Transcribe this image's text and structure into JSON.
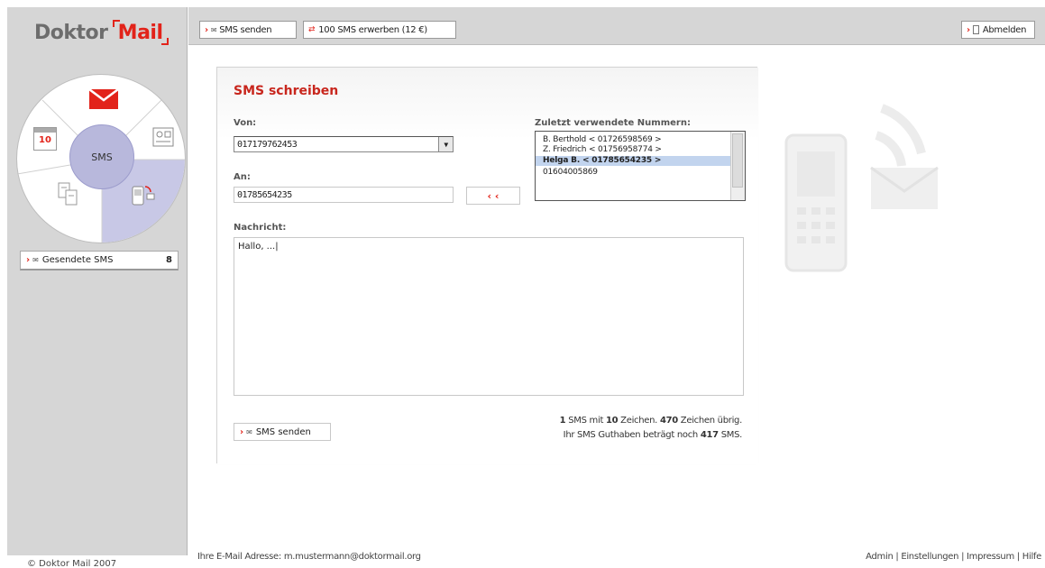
{
  "sidebar": {
    "logo_doktor": "Doktor",
    "logo_mail": "Mail",
    "wheel_center": "SMS",
    "calendar_day": "10",
    "sent_sms_label": "Gesendete SMS",
    "sent_sms_count": "8",
    "copyright": "© Doktor Mail 2007"
  },
  "toolbar": {
    "send_label": "SMS senden",
    "buy_label": "100 SMS erwerben (12 €)",
    "logout_label": "Abmelden"
  },
  "form": {
    "title": "SMS schreiben",
    "from_label": "Von:",
    "from_value": "017179762453",
    "to_label": "An:",
    "to_value": "01785654235",
    "add_button": "‹ ‹",
    "recent_label": "Zuletzt verwendete Nummern:",
    "recent_items": [
      "B. Berthold < 01726598569 >",
      "Z. Friedrich < 01756958774 >",
      "Helga B. < 01785654235 >",
      "01604005869"
    ],
    "message_label": "Nachricht:",
    "message_value": "Hallo, ...|",
    "send_label": "SMS senden",
    "counter_sms_count": "1",
    "counter_chars": "10",
    "counter_remaining": "470",
    "counter_balance": "417",
    "counter_line1_a": " SMS mit ",
    "counter_line1_b": " Zeichen. ",
    "counter_line1_c": " Zeichen übrig.",
    "counter_line2_a": "Ihr SMS Guthaben beträgt noch ",
    "counter_line2_b": " SMS."
  },
  "footer": {
    "email_prefix": "Ihre E-Mail Adresse: ",
    "email": "m.mustermann@doktormail.org",
    "links": [
      "Admin",
      "Einstellungen",
      "Impressum",
      "Hilfe"
    ]
  },
  "colors": {
    "accent": "#e2231a",
    "sidebar_bg": "#d6d6d6",
    "selection": "#c2d4ee",
    "wheel_active": "#b8b8dc"
  }
}
